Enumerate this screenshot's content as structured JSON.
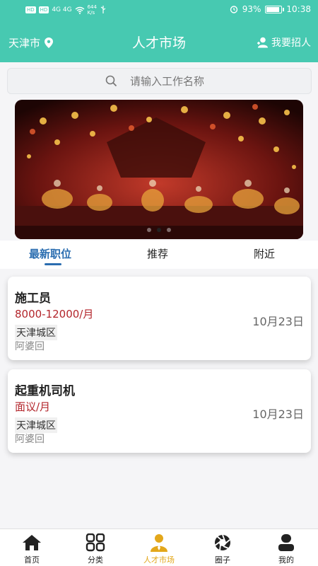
{
  "status_bar": {
    "sim1": "HD",
    "sim2": "HD",
    "signal_text": "4G 4G",
    "speed": "644\nK/s",
    "battery": "93%",
    "battery_level": 0.93,
    "time": "10:38"
  },
  "header": {
    "location": "天津市",
    "title": "人才市场",
    "recruit_label": "我要招人"
  },
  "search": {
    "placeholder": "请输入工作名称"
  },
  "banner": {
    "dot_count": 3,
    "active_dot": 1
  },
  "tabs": [
    {
      "label": "最新职位",
      "active": true
    },
    {
      "label": "推荐",
      "active": false
    },
    {
      "label": "附近",
      "active": false
    }
  ],
  "jobs": [
    {
      "title": "施工员",
      "salary": "8000-12000/月",
      "area": "天津城区",
      "company": "阿婆回",
      "date": "10月23日"
    },
    {
      "title": "起重机司机",
      "salary": "面议/月",
      "area": "天津城区",
      "company": "阿婆回",
      "date": "10月23日"
    }
  ],
  "bottom_nav": [
    {
      "label": "首页",
      "icon": "home-icon"
    },
    {
      "label": "分类",
      "icon": "grid-icon"
    },
    {
      "label": "人才市场",
      "icon": "talent-icon",
      "active": true
    },
    {
      "label": "圈子",
      "icon": "aperture-icon"
    },
    {
      "label": "我的",
      "icon": "profile-icon"
    }
  ],
  "colors": {
    "accent": "#47c9b1",
    "tab_active": "#2a6db0",
    "salary": "#b3252b",
    "nav_active": "#e3a71b"
  }
}
